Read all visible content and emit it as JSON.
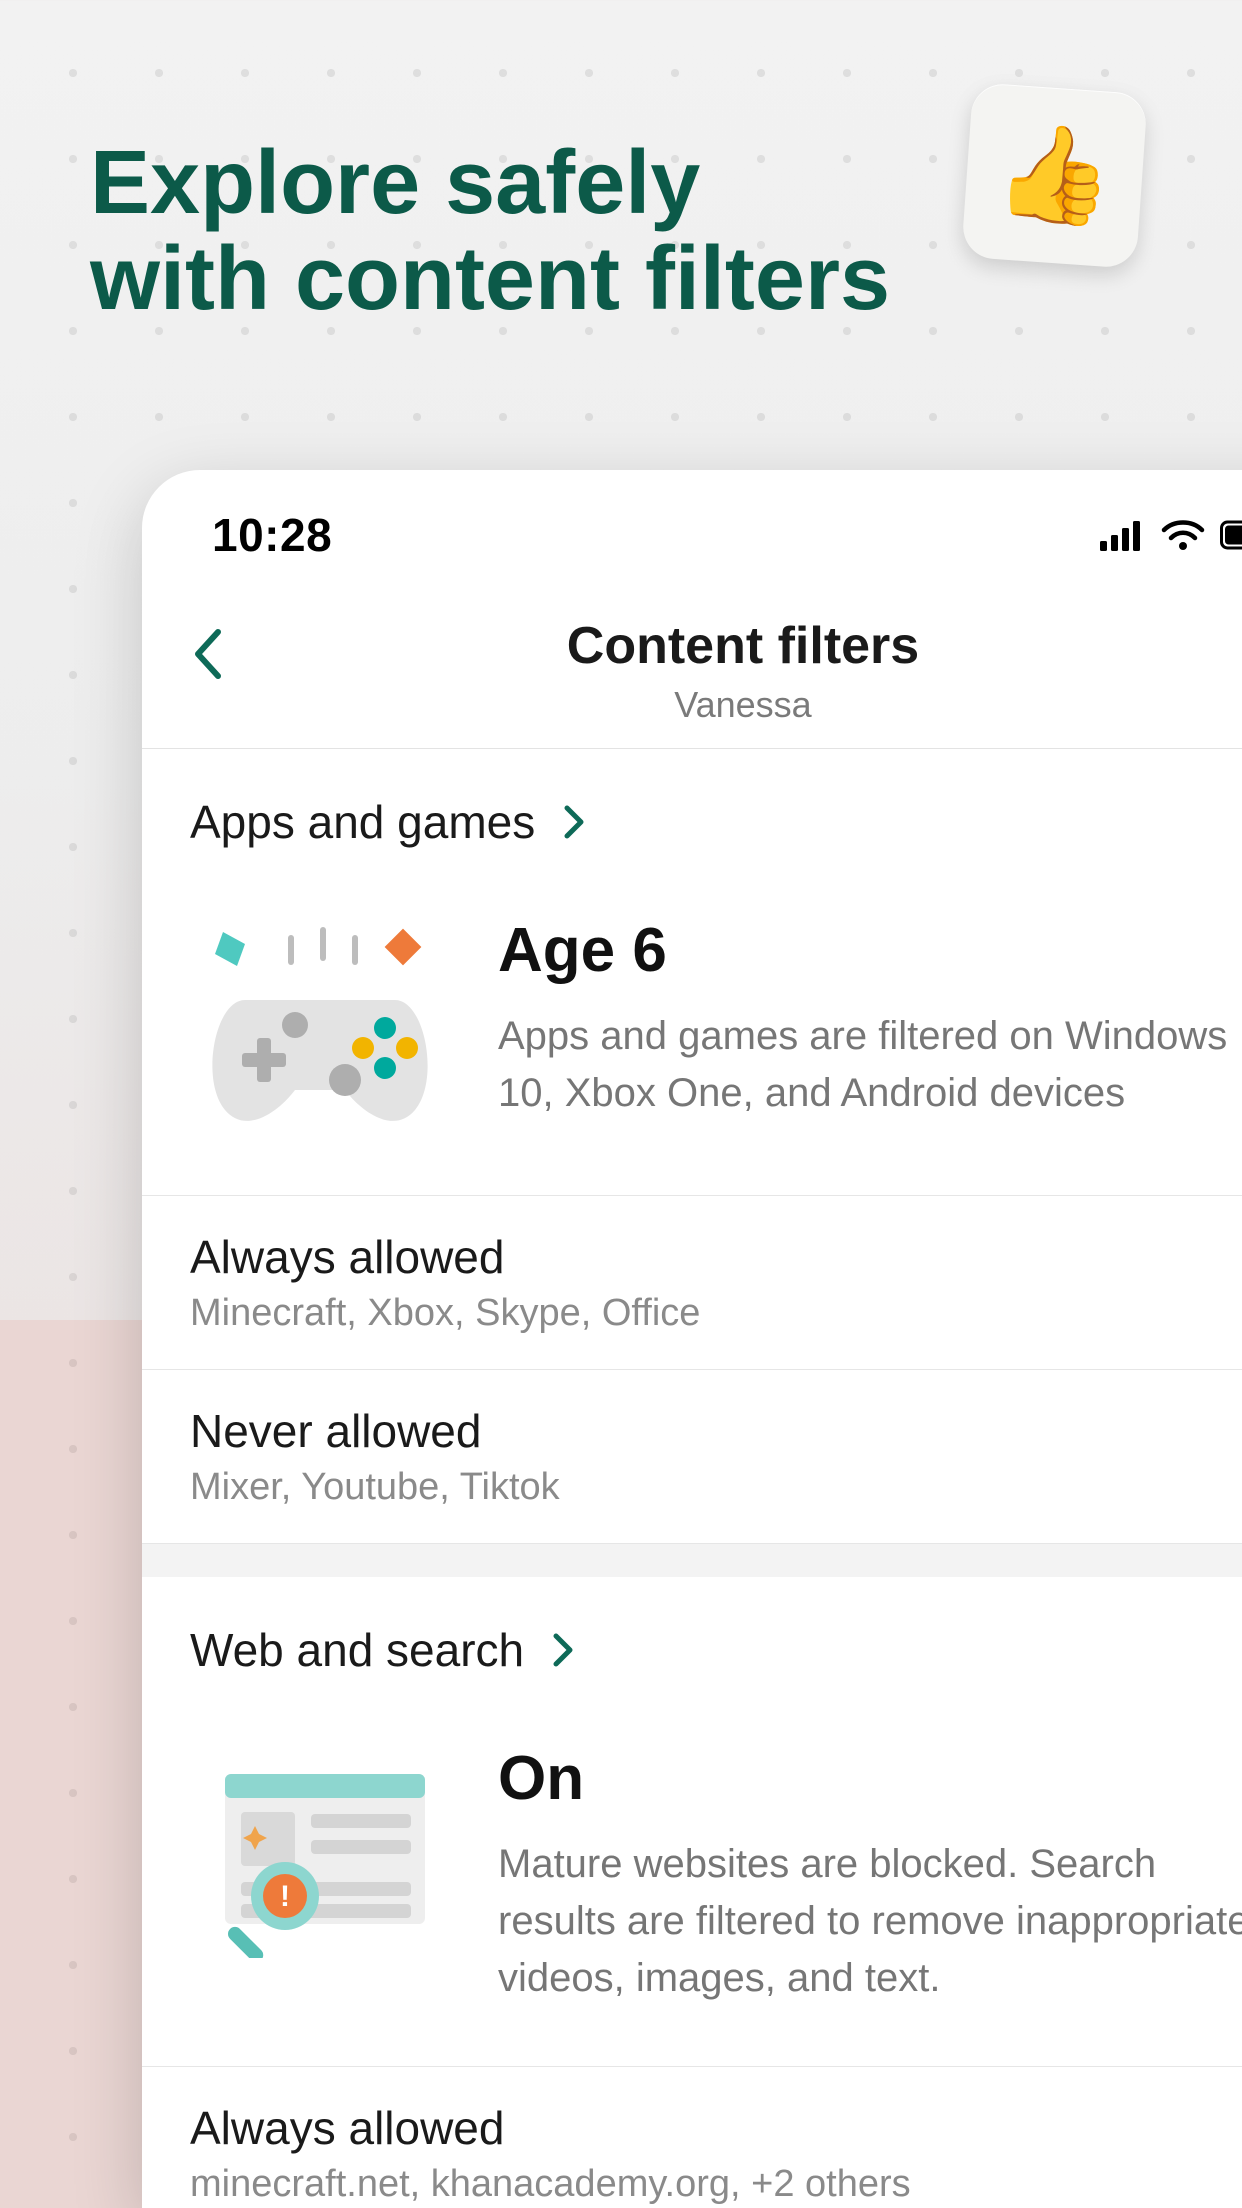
{
  "hero": {
    "headline_line1": "Explore safely",
    "headline_line2": "with content filters",
    "thumb_emoji": "👍"
  },
  "statusbar": {
    "time": "10:28"
  },
  "nav": {
    "title": "Content filters",
    "subtitle": "Vanessa"
  },
  "sections": {
    "apps": {
      "header": "Apps and games",
      "age_title": "Age 6",
      "age_desc": "Apps and games are filtered on Windows 10, Xbox One, and Android devices",
      "always_allowed": {
        "title": "Always allowed",
        "subtitle": "Minecraft, Xbox, Skype, Office"
      },
      "never_allowed": {
        "title": "Never allowed",
        "subtitle": "Mixer, Youtube, Tiktok"
      }
    },
    "web": {
      "header": "Web and search",
      "status_title": "On",
      "status_desc": "Mature websites are blocked. Search results are filtered to remove inappropriate videos, images, and text.",
      "always_allowed": {
        "title": "Always allowed",
        "subtitle": "minecraft.net, khanacademy.org, +2 others"
      }
    }
  }
}
